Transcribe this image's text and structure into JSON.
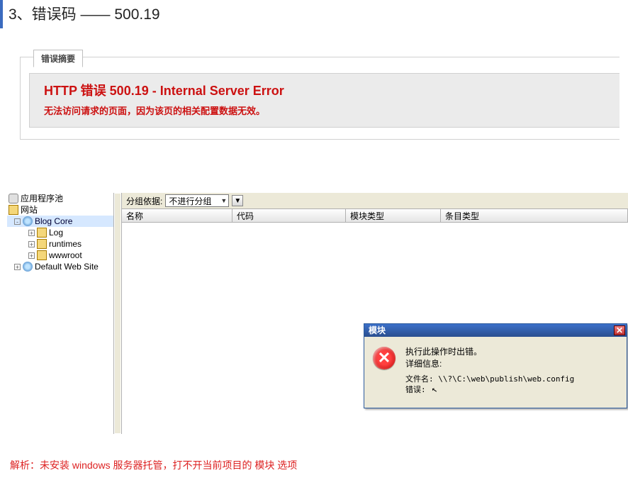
{
  "page": {
    "title": "3、错误码 —— 500.19"
  },
  "error_box": {
    "tab": "错误摘要",
    "title": "HTTP 错误 500.19 - Internal Server Error",
    "desc": "无法访问请求的页面，因为该页的相关配置数据无效。"
  },
  "tree": {
    "app_pool": "应用程序池",
    "sites": "网站",
    "blog_core": "Blog Core",
    "log": "Log",
    "runtimes": "runtimes",
    "wwwroot": "wwwroot",
    "default_site": "Default Web Site"
  },
  "grid": {
    "group_label": "分组依据:",
    "group_value": "不进行分组",
    "group_caret": "▼",
    "action_caret": "▼",
    "cols": {
      "name": "名称",
      "code": "代码",
      "module_type": "模块类型",
      "entry_type": "条目类型"
    }
  },
  "dialog": {
    "title": "模块",
    "close": "✕",
    "err_icon": "✕",
    "msg1": "执行此操作时出错。",
    "msg2": "详细信息:",
    "file_label": "文件名:",
    "file_value": "\\\\?\\C:\\web\\publish\\web.config",
    "err_label": "错误:",
    "cursor": "↖"
  },
  "analysis": {
    "text": "解析：未安装 windows 服务器托管，打不开当前项目的 模块 选项"
  }
}
